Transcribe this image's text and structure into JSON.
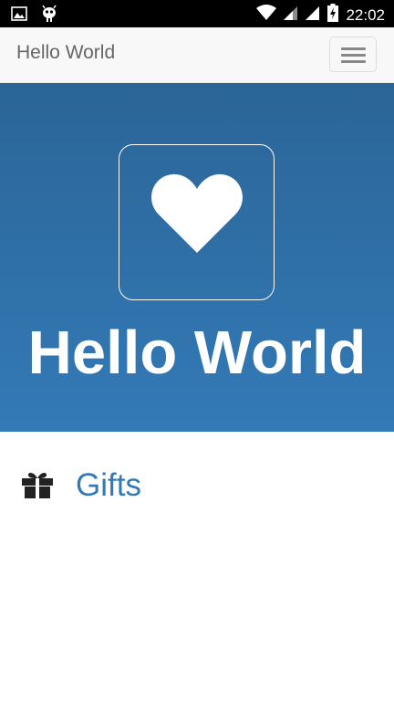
{
  "status_bar": {
    "time": "22:02",
    "icons": [
      "image-icon",
      "debug-bug-icon",
      "wifi-icon",
      "cell-signal-icon",
      "cell-signal-icon",
      "battery-charging-icon"
    ]
  },
  "navbar": {
    "brand": "Hello World",
    "menu_icon": "hamburger-icon"
  },
  "hero": {
    "icon": "heart-icon",
    "title": "Hello World",
    "gradient_top": "#2b6597",
    "gradient_bottom": "#337ab7"
  },
  "list": {
    "items": [
      {
        "icon": "gift-icon",
        "label": "Gifts"
      }
    ]
  },
  "colors": {
    "accent": "#337ab7",
    "navbar_bg": "#f8f8f8",
    "status_bar_bg": "#000000"
  }
}
